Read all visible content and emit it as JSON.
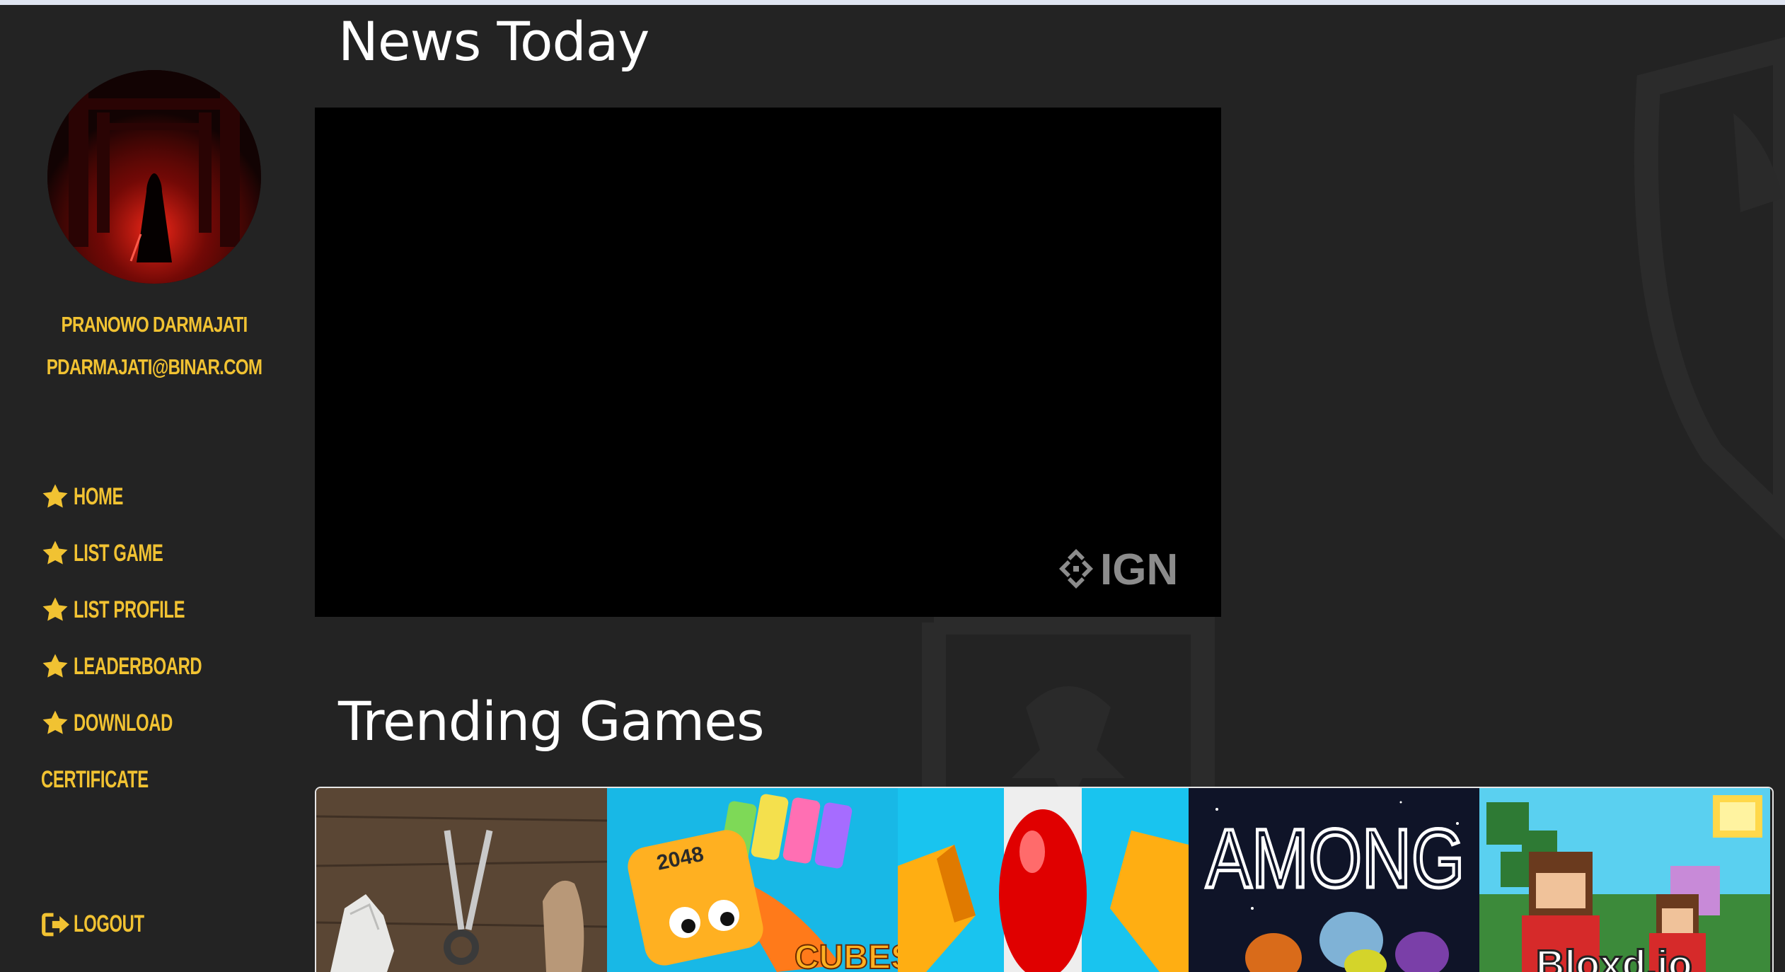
{
  "user": {
    "name": "PRANOWO DARMAJATI",
    "email": "PDARMAJATI@BINAR.COM"
  },
  "nav": {
    "items": [
      {
        "label": "HOME",
        "icon": "star-icon"
      },
      {
        "label": "LIST GAME",
        "icon": "star-icon"
      },
      {
        "label": "LIST PROFILE",
        "icon": "star-icon"
      },
      {
        "label": "LEADERBOARD",
        "icon": "star-icon"
      },
      {
        "label": "DOWNLOAD",
        "icon": "star-icon"
      },
      {
        "label": "CERTIFICATE",
        "icon": null
      }
    ],
    "logout_label": "LOGOUT"
  },
  "news": {
    "title": "News Today",
    "video_brand": "IGN"
  },
  "trending": {
    "title": "Trending Games",
    "games": [
      {
        "name": "rock-paper-scissors"
      },
      {
        "name": "2048 cubes",
        "text": "CUBES"
      },
      {
        "name": "helix-ball"
      },
      {
        "name": "among-us",
        "text": "AMONG US"
      },
      {
        "name": "blocky",
        "text": "Bloxd.io"
      }
    ]
  },
  "colors": {
    "background": "#232323",
    "accent": "#f1c232",
    "title": "#ffffff"
  }
}
